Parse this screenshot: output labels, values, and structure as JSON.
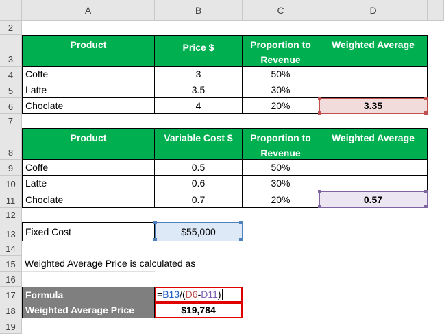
{
  "columns": [
    "A",
    "B",
    "C",
    "D"
  ],
  "rows": [
    "2",
    "3",
    "4",
    "5",
    "6",
    "7",
    "8",
    "9",
    "10",
    "11",
    "12",
    "13",
    "14",
    "15",
    "16",
    "17",
    "18",
    "19"
  ],
  "table1": {
    "headers": [
      "Product",
      "Price $",
      "Proportion to Revenue",
      "Weighted Average"
    ],
    "rows": [
      [
        "Coffe",
        "3",
        "50%",
        ""
      ],
      [
        "Latte",
        "3.5",
        "30%",
        ""
      ],
      [
        "Choclate",
        "4",
        "20%",
        "3.35"
      ]
    ]
  },
  "table2": {
    "headers": [
      "Product",
      "Variable Cost $",
      "Proportion to Revenue",
      "Weighted Average"
    ],
    "rows": [
      [
        "Coffe",
        "0.5",
        "50%",
        ""
      ],
      [
        "Latte",
        "0.6",
        "30%",
        ""
      ],
      [
        "Choclate",
        "0.7",
        "20%",
        "0.57"
      ]
    ]
  },
  "fixed_cost": {
    "label": "Fixed Cost",
    "value": "$55,000"
  },
  "note": "Weighted Average Price is calculated as",
  "formula_row": {
    "label": "Formula",
    "parts": [
      "=",
      "B13",
      "/(",
      "D6",
      "-",
      "D11",
      ")"
    ]
  },
  "result_row": {
    "label": "Weighted Average Price",
    "value": "$19,784"
  },
  "colors": {
    "header_green": "#00b050",
    "gray_label": "#7f7f7f",
    "pink_fill": "#f2dcdb",
    "lavender_fill": "#ece6f2",
    "blue_fill": "#dde9f7",
    "red_border": "#e00000"
  }
}
